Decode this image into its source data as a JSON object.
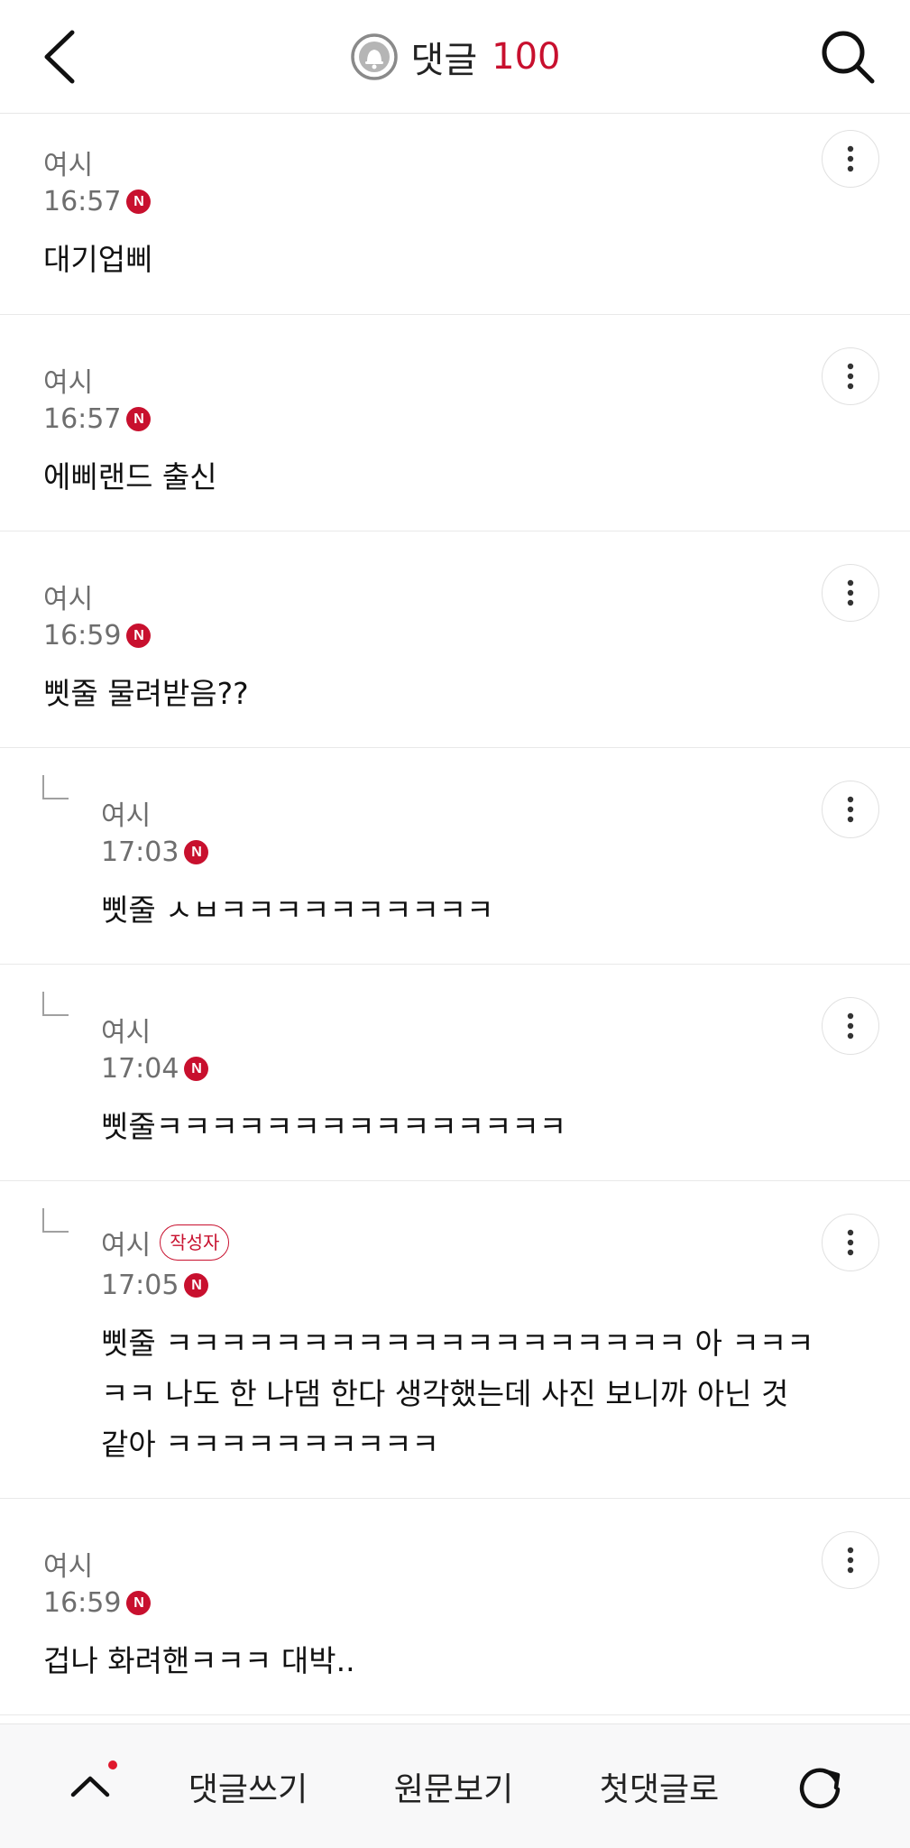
{
  "header": {
    "title": "댓글",
    "count": "100"
  },
  "comments": [
    {
      "author": "여시",
      "time": "16:57",
      "badge": "N",
      "body": "대기업삐",
      "reply": false,
      "writer_tag": ""
    },
    {
      "author": "여시",
      "time": "16:57",
      "badge": "N",
      "body": "에삐랜드 출신",
      "reply": false,
      "writer_tag": ""
    },
    {
      "author": "여시",
      "time": "16:59",
      "badge": "N",
      "body": "삣줄 물려받음??",
      "reply": false,
      "writer_tag": ""
    },
    {
      "author": "여시",
      "time": "17:03",
      "badge": "N",
      "body": "삣줄 ㅅㅂㅋㅋㅋㅋㅋㅋㅋㅋㅋㅋ",
      "reply": true,
      "writer_tag": ""
    },
    {
      "author": "여시",
      "time": "17:04",
      "badge": "N",
      "body": "삣줄ㅋㅋㅋㅋㅋㅋㅋㅋㅋㅋㅋㅋㅋㅋㅋ",
      "reply": true,
      "writer_tag": ""
    },
    {
      "author": "여시",
      "time": "17:05",
      "badge": "N",
      "body": "삣줄 ㅋㅋㅋㅋㅋㅋㅋㅋㅋㅋㅋㅋㅋㅋㅋㅋㅋㅋㅋ 아 ㅋㅋㅋ\nㅋㅋ 나도 한 나댐 한다 생각했는데 사진 보니까 아닌 것\n같아 ㅋㅋㅋㅋㅋㅋㅋㅋㅋㅋ",
      "reply": true,
      "writer_tag": "작성자"
    },
    {
      "author": "여시",
      "time": "16:59",
      "badge": "N",
      "body": "겁나 화려핸ㅋㅋㅋ 대박..",
      "reply": false,
      "writer_tag": ""
    }
  ],
  "bottom": {
    "write": "댓글쓰기",
    "original": "원문보기",
    "first": "첫댓글로"
  },
  "colors": {
    "accent": "#c8102e",
    "meta_text": "#6e6e6e"
  },
  "icons": [
    "back-arrow-icon",
    "bell-icon",
    "search-icon",
    "more-vertical-icon",
    "reply-indent-icon",
    "chevron-up-icon",
    "refresh-icon"
  ]
}
